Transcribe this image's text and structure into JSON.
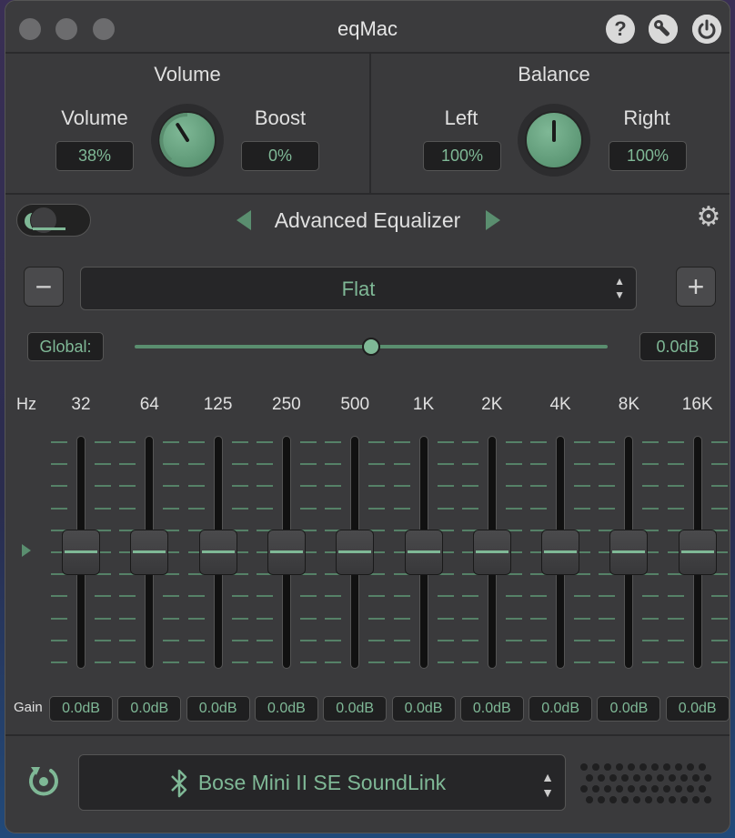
{
  "window": {
    "title": "eqMac"
  },
  "icons": {
    "help": "?",
    "gear": "⚙"
  },
  "volume": {
    "section_title": "Volume",
    "volume_label": "Volume",
    "volume_value": "38%",
    "boost_label": "Boost",
    "boost_value": "0%",
    "knob_level": 0.38
  },
  "balance": {
    "section_title": "Balance",
    "left_label": "Left",
    "left_value": "100%",
    "right_label": "Right",
    "right_value": "100%",
    "knob_level": 0.5
  },
  "equalizer": {
    "enabled": true,
    "title": "Advanced Equalizer",
    "preset": "Flat",
    "minus_label": "−",
    "plus_label": "+",
    "global_label": "Global:",
    "global_value": "0.0dB",
    "global_level": 0.5,
    "hz_label": "Hz",
    "gain_label": "Gain",
    "bands": [
      {
        "freq": "32",
        "gain": "0.0dB",
        "level": 0.5
      },
      {
        "freq": "64",
        "gain": "0.0dB",
        "level": 0.5
      },
      {
        "freq": "125",
        "gain": "0.0dB",
        "level": 0.5
      },
      {
        "freq": "250",
        "gain": "0.0dB",
        "level": 0.5
      },
      {
        "freq": "500",
        "gain": "0.0dB",
        "level": 0.5
      },
      {
        "freq": "1K",
        "gain": "0.0dB",
        "level": 0.5
      },
      {
        "freq": "2K",
        "gain": "0.0dB",
        "level": 0.5
      },
      {
        "freq": "4K",
        "gain": "0.0dB",
        "level": 0.5
      },
      {
        "freq": "8K",
        "gain": "0.0dB",
        "level": 0.5
      },
      {
        "freq": "16K",
        "gain": "0.0dB",
        "level": 0.5
      }
    ]
  },
  "output": {
    "device": "Bose Mini II SE SoundLink"
  },
  "colors": {
    "accent": "#7fb896",
    "background": "#3a3a3c",
    "field": "#1f1f20"
  }
}
